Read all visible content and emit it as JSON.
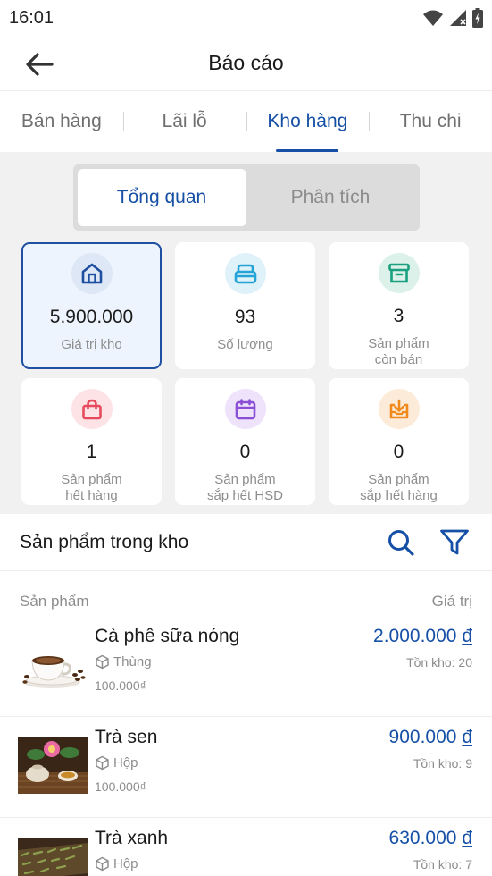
{
  "status": {
    "time": "16:01"
  },
  "header": {
    "title": "Báo cáo"
  },
  "tabs": [
    {
      "label": "Bán hàng",
      "active": false
    },
    {
      "label": "Lãi lỗ",
      "active": false
    },
    {
      "label": "Kho hàng",
      "active": true
    },
    {
      "label": "Thu chi",
      "active": false
    }
  ],
  "segments": [
    {
      "label": "Tổng quan",
      "active": true
    },
    {
      "label": "Phân tích",
      "active": false
    }
  ],
  "cards": [
    {
      "value": "5.900.000",
      "label": "Giá trị kho",
      "label2": "",
      "icon": "warehouse-icon",
      "color": "#1e4fa0",
      "bg": "#dde7f6"
    },
    {
      "value": "93",
      "label": "Số lượng",
      "label2": "",
      "icon": "box-icon",
      "color": "#24a4d6",
      "bg": "#dff1f9"
    },
    {
      "value": "3",
      "label": "Sản phẩm",
      "label2": "còn bán",
      "icon": "archive-icon",
      "color": "#19a07e",
      "bg": "#ddf1eb"
    },
    {
      "value": "1",
      "label": "Sản phẩm",
      "label2": "hết hàng",
      "icon": "bag-icon",
      "color": "#e64b5d",
      "bg": "#fde3e6"
    },
    {
      "value": "0",
      "label": "Sản phẩm",
      "label2": "sắp hết HSD",
      "icon": "calendar-icon",
      "color": "#8b4fd6",
      "bg": "#eee3fb"
    },
    {
      "value": "0",
      "label": "Sản phẩm",
      "label2": "sắp hết hàng",
      "icon": "download-box-icon",
      "color": "#f08a1c",
      "bg": "#fdebd9"
    }
  ],
  "inventory": {
    "title": "Sản phẩm trong kho",
    "col_product": "Sản phẩm",
    "col_value": "Giá trị"
  },
  "products": [
    {
      "name": "Cà phê sữa nóng",
      "unit": "Thùng",
      "price": "100.000₫",
      "value": "2.000.000",
      "currency": "đ",
      "stock": "Tồn kho: 20",
      "image": "coffee-cup"
    },
    {
      "name": "Trà sen",
      "unit": "Hộp",
      "price": "100.000₫",
      "value": "900.000",
      "currency": "đ",
      "stock": "Tồn kho: 9",
      "image": "lotus-tea"
    },
    {
      "name": "Trà xanh",
      "unit": "Hộp",
      "price": "",
      "value": "630.000",
      "currency": "đ",
      "stock": "Tồn kho: 7",
      "image": "green-tea"
    }
  ],
  "colors": {
    "accent": "#1650a6",
    "muted": "#8d8d8d",
    "background": "#f1f1f2"
  }
}
